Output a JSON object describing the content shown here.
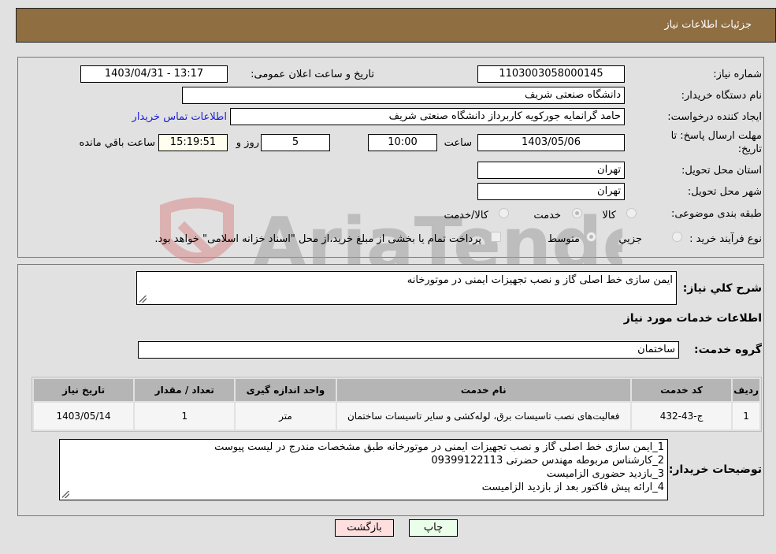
{
  "header": {
    "title": "جزئیات اطلاعات نیاز"
  },
  "form": {
    "need_number_label": "شماره نیاز:",
    "need_number": "1103003058000145",
    "announce_label": "تاریخ و ساعت اعلان عمومی:",
    "announce_value": "1403/04/31 - 13:17",
    "buyer_org_label": "نام دستگاه خریدار:",
    "buyer_org": "دانشگاه صنعتی شریف",
    "creator_label": "ایجاد کننده درخواست:",
    "creator": "حامد گرانمایه جورکویه کاربرداز دانشگاه صنعتی شریف",
    "contact_link": "اطلاعات تماس خریدار",
    "deadline_label_1": "مهلت ارسال پاسخ: تا",
    "deadline_label_2": "تاریخ:",
    "deadline_date": "1403/05/06",
    "time_label": "ساعت",
    "deadline_time": "10:00",
    "days": "5",
    "days_label": "روز و",
    "remaining_time": "15:19:51",
    "remaining_label": "ساعت باقي مانده",
    "province_label": "استان محل تحویل:",
    "province": "تهران",
    "city_label": "شهر محل تحویل:",
    "city": "تهران",
    "category_label": "طبقه بندی موضوعی:",
    "category_options": [
      {
        "label": "کالا",
        "checked": false
      },
      {
        "label": "خدمت",
        "checked": true
      },
      {
        "label": "کالا/خدمت",
        "checked": false
      }
    ],
    "process_label": "نوع فرآیند خرید :",
    "process_options": [
      {
        "label": "جزيي",
        "checked": false
      },
      {
        "label": "متوسط",
        "checked": true
      }
    ],
    "treasury_note": "پرداخت تمام یا بخشی از مبلغ خرید،از محل \"اسناد خزانه اسلامی\" خواهد بود."
  },
  "details": {
    "summary_label": "شرح کلي نياز:",
    "summary": "ایمن سازی خط اصلی گاز و نصب تجهیزات ایمنی در موتورخانه",
    "services_heading": "اطلاعات خدمات مورد نیاز",
    "service_group_label": "گروه خدمت:",
    "service_group": "ساختمان",
    "table": {
      "headers": [
        "ردیف",
        "کد خدمت",
        "نام خدمت",
        "واحد اندازه گیری",
        "تعداد / مقدار",
        "تاریخ نیاز"
      ],
      "rows": [
        [
          "1",
          "ج-43-432",
          "فعالیت‌های نصب تاسیسات برق، لوله‌کشی و سایر تاسیسات ساختمان",
          "متر",
          "1",
          "1403/05/14"
        ]
      ]
    },
    "buyer_notes_label": "توضیحات خریدار:",
    "buyer_notes": [
      "1_ایمن سازی خط اصلی گاز و نصب تجهیزات ایمنی در موتورخانه طبق مشخصات مندرج در لیست پیوست",
      "2_کارشناس مربوطه مهندس حضرتی 09399122113",
      "3_بازدید حضوری الزامیست",
      "4_ارائه پیش فاکتور بعد از بازدید الزامیست"
    ]
  },
  "buttons": {
    "print": "چاپ",
    "back": "بازگشت"
  },
  "colors": {
    "header_bg": "#8f6e42",
    "print_bg": "#eaffea",
    "back_bg": "#ffdede",
    "link": "#1c1cd4"
  },
  "watermark": {
    "text": "AriaTender.neT"
  }
}
